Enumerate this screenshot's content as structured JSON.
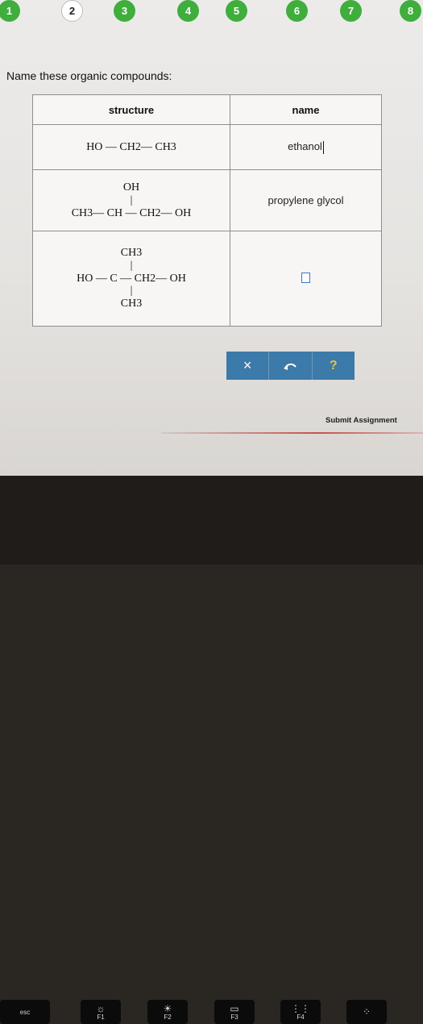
{
  "stepper": {
    "steps": [
      "1",
      "2",
      "3",
      "4",
      "5",
      "6",
      "7",
      "8"
    ],
    "current": "2",
    "completed_color": "#3fae3c"
  },
  "question": {
    "prompt": "Name these organic compounds:"
  },
  "table": {
    "headers": {
      "structure": "structure",
      "name": "name"
    },
    "rows": [
      {
        "structure_lines": [
          "HO — CH2— CH3"
        ],
        "name_value": "ethanol"
      },
      {
        "structure_lines": [
          "OH",
          "|",
          "CH3— CH — CH2— OH"
        ],
        "name_value": "propylene glycol"
      },
      {
        "structure_lines": [
          "CH3",
          "|",
          "HO — C — CH2— OH",
          "|",
          "CH3"
        ],
        "name_value": ""
      }
    ]
  },
  "toolbar": {
    "clear_icon": "x-icon",
    "undo_icon": "undo-icon",
    "help_icon": "help-icon",
    "clear_label": "×",
    "help_label": "?",
    "accent": "#3c7aa9"
  },
  "submit": {
    "label": "Submit Assignment"
  },
  "keyboard": {
    "esc": "esc",
    "f1": "F1",
    "f2": "F2",
    "f3": "F3",
    "f4": "F4"
  }
}
